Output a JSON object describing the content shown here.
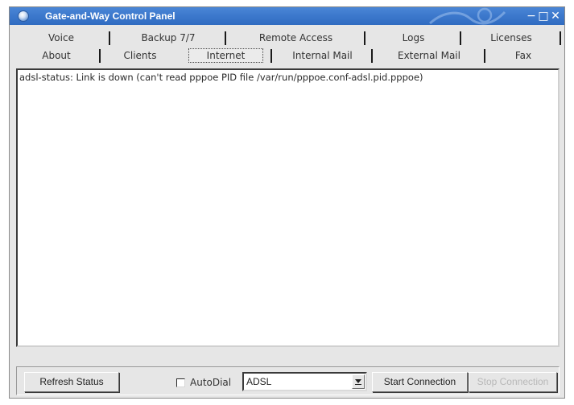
{
  "window": {
    "title": "Gate-and-Way Control Panel",
    "title_bar_color": "#3c78cc",
    "icons": {
      "app": "app-globe-icon",
      "minimize": "minimize-icon",
      "maximize": "maximize-icon",
      "close": "close-icon"
    },
    "controls": {
      "minimize": "−",
      "maximize": "□",
      "close": "✕"
    }
  },
  "tabs": {
    "row1": [
      "Voice",
      "Backup 7/7",
      "Remote Access",
      "Logs",
      "Licenses"
    ],
    "row2": [
      "About",
      "Clients",
      "Internet",
      "Internal Mail",
      "External Mail",
      "Fax"
    ],
    "active": "Internet"
  },
  "content": {
    "status_text": "adsl-status: Link is down (can't read pppoe PID file /var/run/pppoe.conf-adsl.pid.pppoe)"
  },
  "bottom_bar": {
    "refresh_button": "Refresh Status",
    "autodial_label": "AutoDial",
    "autodial_checked": false,
    "connection_type": "ADSL",
    "start_button": "Start Connection",
    "stop_button": "Stop Connection",
    "stop_enabled": false
  }
}
